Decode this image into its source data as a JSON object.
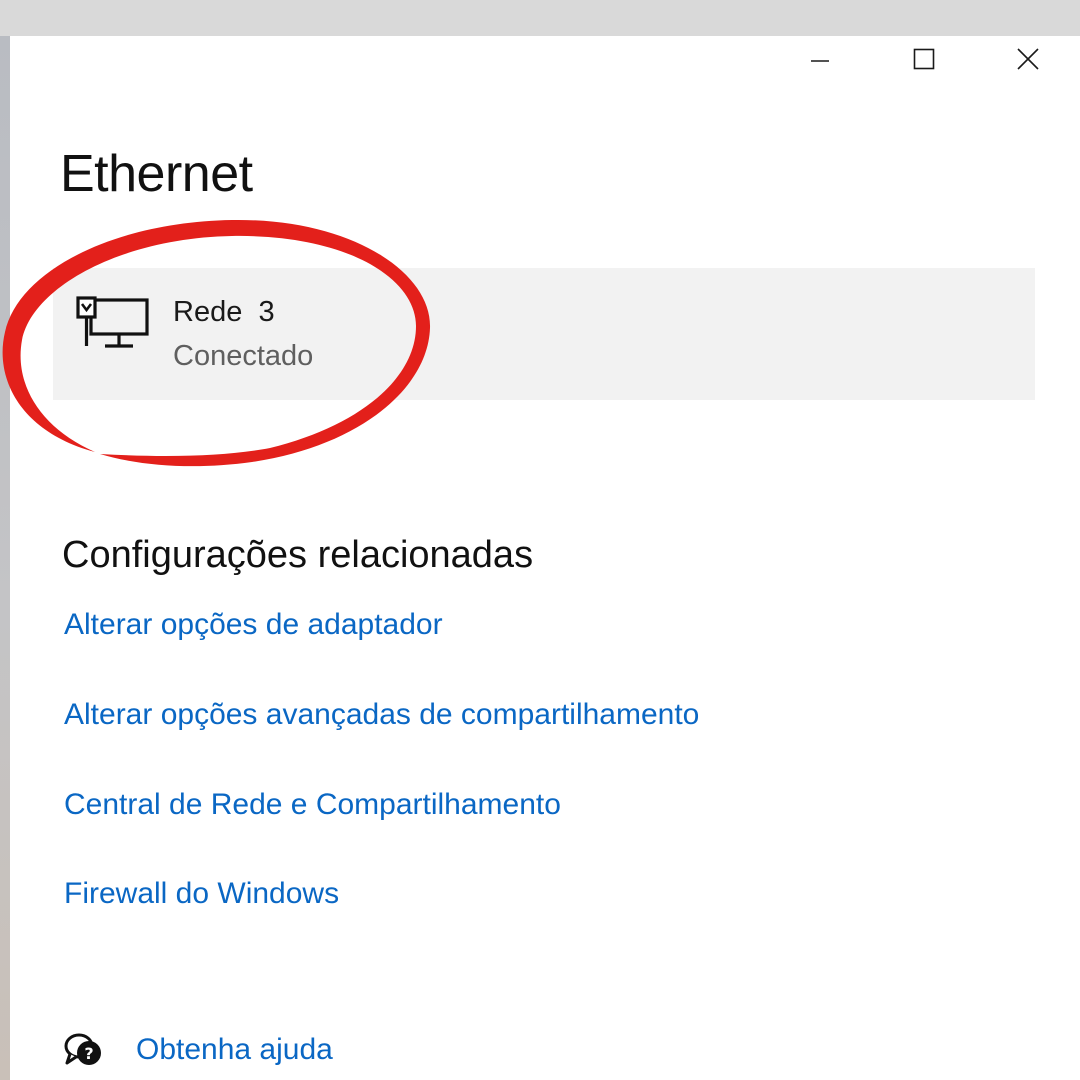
{
  "window": {
    "controls": {
      "minimize_icon": "minimize-icon",
      "maximize_icon": "maximize-icon",
      "close_icon": "close-icon"
    }
  },
  "page": {
    "title": "Ethernet"
  },
  "network": {
    "icon": "ethernet-monitor-icon",
    "name": "Rede  3",
    "status": "Conectado",
    "highlight_color": "#e3201b"
  },
  "related_settings": {
    "heading": "Configurações relacionadas",
    "links": [
      "Alterar opções de adaptador",
      "Alterar opções avançadas de compartilhamento",
      "Central de Rede e Compartilhamento",
      "Firewall do Windows"
    ]
  },
  "help": {
    "icon": "help-chat-icon",
    "label": "Obtenha ajuda"
  },
  "colors": {
    "link": "#0a67c4",
    "card_background": "#f2f2f2",
    "title_bar_strip": "#d9d9d9"
  }
}
